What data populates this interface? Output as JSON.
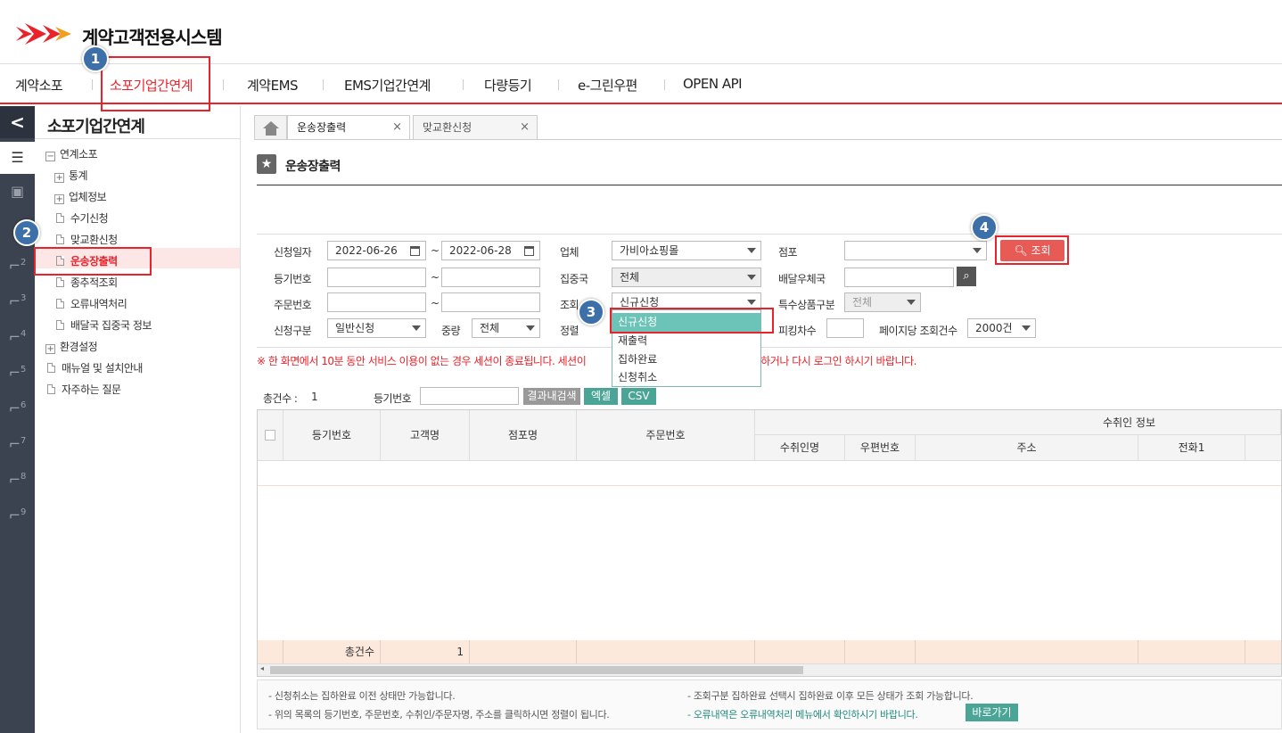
{
  "brand": {
    "title": "계약고객전용시스템"
  },
  "topnav": {
    "items": [
      {
        "label": "계약소포"
      },
      {
        "label": "소포기업간연계"
      },
      {
        "label": "계약EMS"
      },
      {
        "label": "EMS기업간연계"
      },
      {
        "label": "다량등기"
      },
      {
        "label": "e-그린우편"
      },
      {
        "label": "OPEN API"
      }
    ],
    "active_index": 1
  },
  "rail": {
    "collapse": "<",
    "numbers": [
      "2",
      "3",
      "4",
      "5",
      "6",
      "7",
      "8",
      "9"
    ]
  },
  "sidebar": {
    "title": "소포기업간연계",
    "tree": [
      {
        "label": "연계소포",
        "type": "minus"
      },
      {
        "label": "통계",
        "type": "plus"
      },
      {
        "label": "업체정보",
        "type": "plus"
      },
      {
        "label": "수기신청",
        "type": "doc"
      },
      {
        "label": "맞교환신청",
        "type": "doc"
      },
      {
        "label": "운송장출력",
        "type": "doc",
        "active": true
      },
      {
        "label": "종추적조회",
        "type": "doc"
      },
      {
        "label": "오류내역처리",
        "type": "doc"
      },
      {
        "label": "배달국 집중국 정보",
        "type": "doc"
      },
      {
        "label": "환경설정",
        "type": "plus"
      },
      {
        "label": "매뉴얼 및 설치안내",
        "type": "doc"
      },
      {
        "label": "자주하는 질문",
        "type": "doc"
      }
    ]
  },
  "tabs": [
    {
      "label": "운송장출력",
      "close": "×"
    },
    {
      "label": "맞교환신청",
      "close": "×"
    }
  ],
  "page": {
    "title": "운송장출력"
  },
  "search": {
    "labels": {
      "apply_date": "신청일자",
      "reg_no": "등기번호",
      "order_no": "주문번호",
      "apply_type": "신청구분",
      "company": "업체",
      "hub": "집중국",
      "query_type": "조회",
      "sort": "정렬",
      "store": "점포",
      "delivery_office": "배달우체국",
      "special_type": "특수상품구분",
      "picking": "피킹차수",
      "per_page": "페이지당 조회건수",
      "weight": "중량"
    },
    "tilde": "~",
    "date_from": "2022-06-26",
    "date_to": "2022-06-28",
    "company_value": "가비아쇼핑몰",
    "hub_value": "전체",
    "query_value": "신규신청",
    "special_value": "전체",
    "apply_type_value": "일반신청",
    "weight_value": "전체",
    "per_page_value": "2000건",
    "search_button": "조회",
    "dropdown_options": [
      "신규신청",
      "재출력",
      "집하완료",
      "신청취소"
    ]
  },
  "warning_prefix": "※ 한 화면에서 10분 동안 서비스 이용이 없는 경우 세션이 종료됩니다. 세션이",
  "warning_suffix": "하거나 다시 로그인 하시기 바랍니다.",
  "result": {
    "total_label": "총건수 :",
    "total_value": "1",
    "reg_no_label": "등기번호",
    "btn_filter": "결과내검색",
    "btn_excel": "엑셀",
    "btn_csv": "CSV"
  },
  "table": {
    "headers": [
      "등기번호",
      "고객명",
      "점포명",
      "주문번호"
    ],
    "group_header": "수취인 정보",
    "sub_headers": [
      "수취인명",
      "우편번호",
      "주소",
      "전화1"
    ],
    "footer_label": "총건수",
    "footer_value": "1"
  },
  "notes": {
    "n1": "- 신청취소는 집하완료 이전 상태만 가능합니다.",
    "n2": "- 위의 목록의 등기번호, 주문번호, 수취인/주문자명, 주소를 클릭하시면 정렬이 됩니다.",
    "n3": "- 조회구분 집하완료 선택시 집하완료 이후 모든 상태가 조회 가능합니다.",
    "n4": "- 오류내역은 오류내역처리 메뉴에서 확인하시기 바랍니다.",
    "goto_button": "바로가기"
  },
  "annotations": [
    "1",
    "2",
    "3",
    "4"
  ],
  "colors": {
    "accent": "#e8232b",
    "teal": "#4aa596",
    "badge": "#3d6fa8"
  }
}
